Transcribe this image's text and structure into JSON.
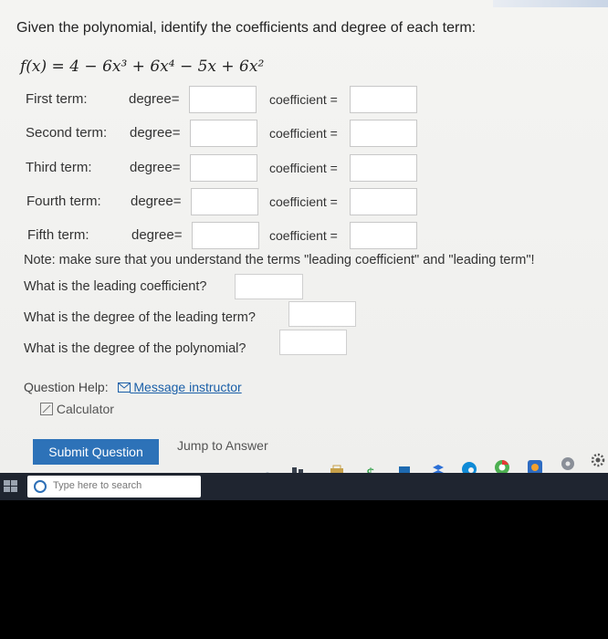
{
  "title": "Given the polynomial, identify the coefficients and degree of each term:",
  "formula": "f(x) = 4 − 6x³ + 6x⁴ − 5x + 6x²",
  "rows": [
    {
      "label": "First term:",
      "degree": "degree=",
      "coefficient": "coefficient ="
    },
    {
      "label": "Second term:",
      "degree": "degree=",
      "coefficient": "coefficient ="
    },
    {
      "label": "Third term:",
      "degree": "degree=",
      "coefficient": "coefficient ="
    },
    {
      "label": "Fourth term:",
      "degree": "degree=",
      "coefficient": "coefficient ="
    },
    {
      "label": "Fifth term:",
      "degree": "degree=",
      "coefficient": "coefficient ="
    }
  ],
  "note": "Note: make sure that you understand the terms \"leading coefficient\" and \"leading term\"!",
  "questions": {
    "leading_coefficient": "What is the leading coefficient?",
    "leading_term_degree": "What is the degree of the leading term?",
    "polynomial_degree": "What is the degree of the polynomial?"
  },
  "help": {
    "label": "Question Help:",
    "message": "Message instructor",
    "calculator": "Calculator"
  },
  "buttons": {
    "submit": "Submit Question",
    "jump": "Jump to Answer"
  },
  "taskbar": {
    "search_placeholder": "Type here to search"
  },
  "colors": {
    "submit_bg": "#2d72b8",
    "link": "#1a5fa8",
    "taskbar": "#1f2530"
  }
}
